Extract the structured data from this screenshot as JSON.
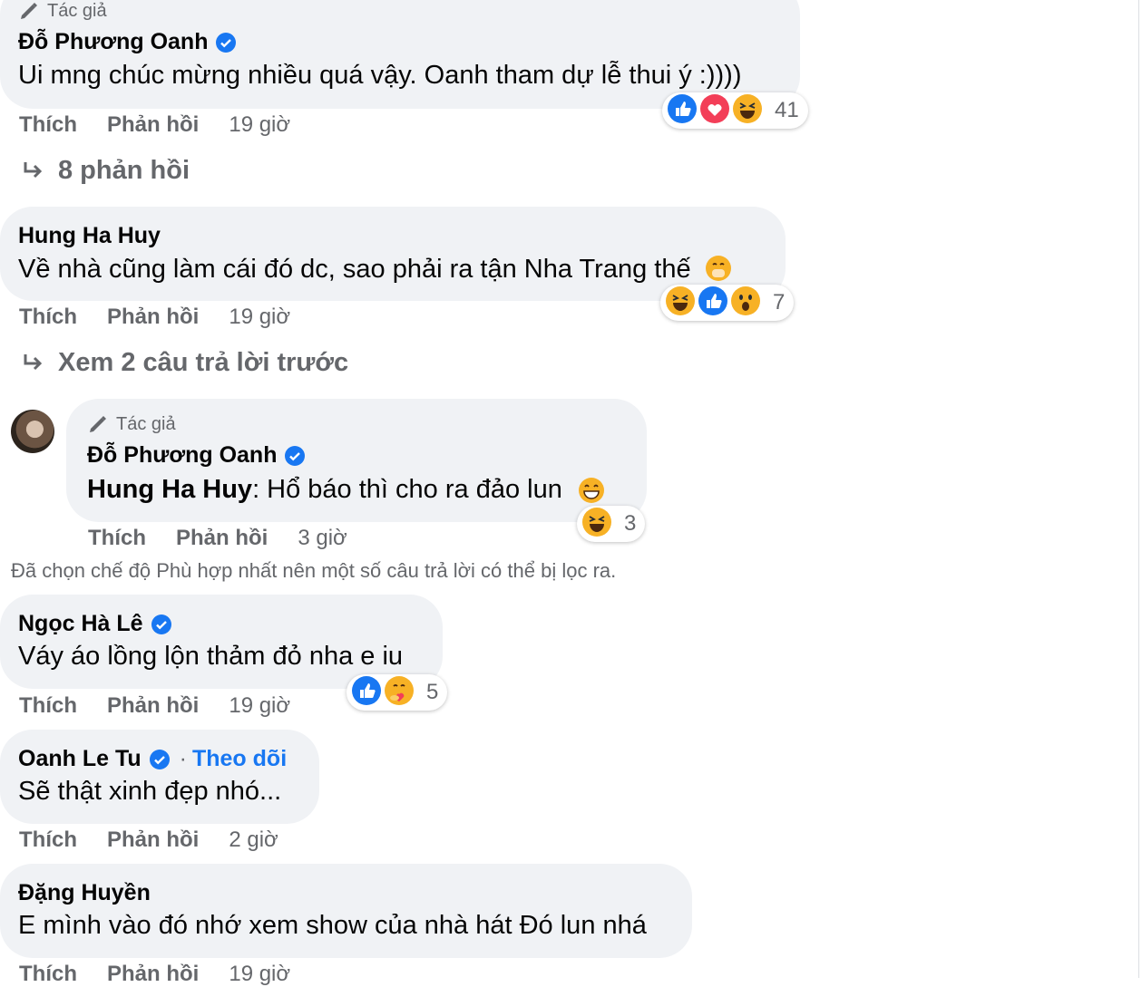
{
  "comments": [
    {
      "author_tag": "Tác giả",
      "name": "Đỗ Phương Oanh",
      "text": "Ui mng chúc mừng nhiều quá vậy. Oanh tham dự lễ thui ý :))))",
      "like": "Thích",
      "reply": "Phản hồi",
      "time": "19 giờ",
      "reaction_count": "41",
      "replies_link": "8 phản hồi"
    },
    {
      "name": "Hung Ha Huy",
      "text": "Về nhà cũng làm cái đó dc, sao phải ra tận Nha Trang thế",
      "like": "Thích",
      "reply": "Phản hồi",
      "time": "19 giờ",
      "reaction_count": "7",
      "replies_link": "Xem 2 câu trả lời trước"
    },
    {
      "author_tag": "Tác giả",
      "name": "Đỗ Phương Oanh",
      "mention": "Hung Ha Huy",
      "text": ": Hổ báo thì cho ra đảo lun",
      "like": "Thích",
      "reply": "Phản hồi",
      "time": "3 giờ",
      "reaction_count": "3"
    },
    {
      "name": "Ngọc Hà Lê",
      "text": "Váy áo lồng lộn thảm đỏ nha e iu",
      "like": "Thích",
      "reply": "Phản hồi",
      "time": "19 giờ",
      "reaction_count": "5"
    },
    {
      "name": "Oanh Le Tu",
      "separator": "·",
      "follow": "Theo dõi",
      "text": "Sẽ thật xinh đẹp nhó...",
      "like": "Thích",
      "reply": "Phản hồi",
      "time": "2 giờ"
    },
    {
      "name": "Đặng Huyền",
      "text": "E mình vào đó nhớ xem show của nhà hát Đó lun nhá",
      "like": "Thích",
      "reply": "Phản hồi",
      "time": "19 giờ"
    }
  ],
  "filter_notice": "Đã chọn chế độ Phù hợp nhất nên một số câu trả lời có thể bị lọc ra.",
  "colors": {
    "bubble": "#f0f2f5",
    "secondary_text": "#65676b",
    "link": "#1877f2",
    "verified": "#1877f2"
  },
  "icons": [
    "pencil-icon",
    "verified-icon",
    "reply-arrow-icon",
    "like-reaction-icon",
    "love-reaction-icon",
    "haha-reaction-icon",
    "wow-reaction-icon",
    "care-reaction-icon"
  ]
}
